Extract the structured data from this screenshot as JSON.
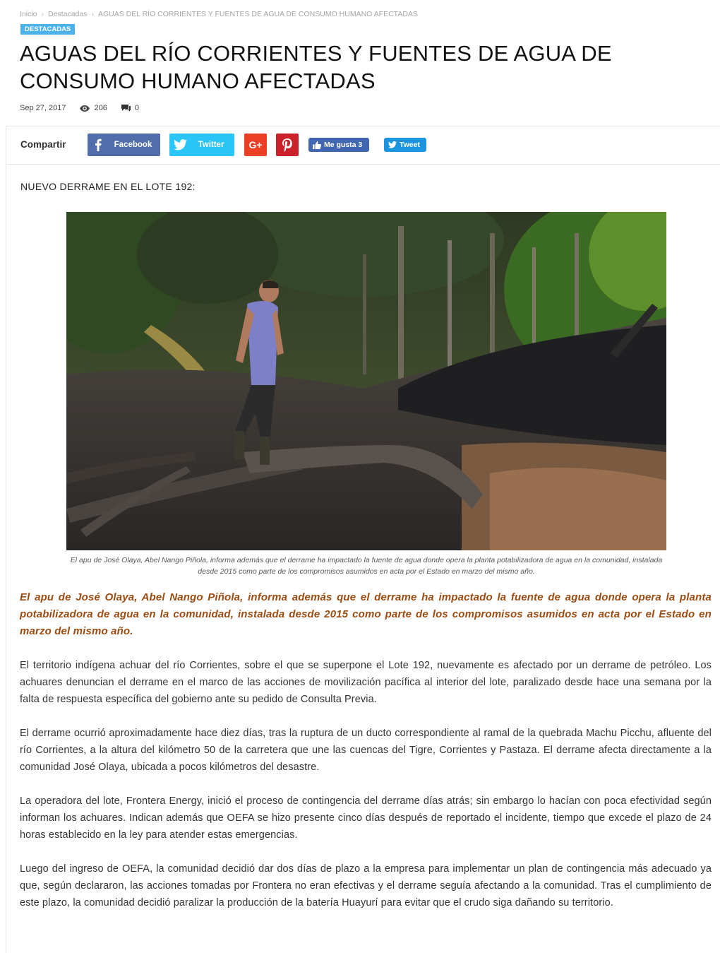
{
  "breadcrumb": {
    "home": "Inicio",
    "category": "Destacadas",
    "current": "AGUAS DEL RÍO CORRIENTES Y FUENTES DE AGUA DE CONSUMO HUMANO AFECTADAS"
  },
  "category_tag": "DESTACADAS",
  "title": "AGUAS DEL RÍO CORRIENTES Y FUENTES DE AGUA DE CONSUMO HUMANO AFECTADAS",
  "meta": {
    "date": "Sep 27, 2017",
    "views": "206",
    "comments": "0"
  },
  "share": {
    "label": "Compartir",
    "facebook": "Facebook",
    "twitter": "Twitter",
    "like": "Me gusta 3",
    "tweet": "Tweet"
  },
  "colors": {
    "accent": "#4db2ec",
    "facebook": "#516eab",
    "twitter": "#29c5f6",
    "googleplus": "#eb4026",
    "pinterest": "#ca212a",
    "lead_text": "#9a4b12"
  },
  "icons": [
    "eye-icon",
    "comment-icon",
    "facebook-icon",
    "twitter-icon",
    "google-plus-icon",
    "pinterest-icon",
    "thumbs-up-icon",
    "twitter-bird-icon"
  ],
  "article": {
    "intro": "NUEVO DERRAME EN EL LOTE 192:",
    "caption": "El apu de José Olaya, Abel Nango Piñola, informa además que el derrame ha impactado la fuente de agua donde opera la planta potabilizadora de agua en la comunidad, instalada desde 2015 como parte de los compromisos asumidos en acta por el Estado en marzo del mismo año.",
    "lead": "El apu de José Olaya, Abel Nango Piñola, informa además que el derrame ha impactado la fuente de agua donde opera la planta potabilizadora de agua en la comunidad, instalada desde 2015 como parte de los compromisos asumidos en acta por el Estado en marzo del mismo año.",
    "paragraphs": [
      "El territorio indígena achuar del río Corrientes, sobre el que se superpone el Lote 192, nuevamente es afectado por un derrame de petróleo. Los achuares denuncian el derrame en el marco de las acciones de movilización pacífica al interior del lote, paralizado desde hace una semana por la falta de respuesta específica del gobierno ante su pedido de Consulta Previa.",
      "El derrame ocurrió aproximadamente hace diez días, tras la ruptura de un ducto correspondiente al ramal de la quebrada Machu Picchu, afluente del río Corrientes, a la altura del kilómetro 50 de la carretera que une las cuencas del Tigre, Corrientes y Pastaza. El derrame afecta directamente a la comunidad José Olaya, ubicada a pocos kilómetros del desastre.",
      "La operadora del lote, Frontera Energy, inició el proceso de contingencia del derrame días atrás; sin embargo lo hacían con poca efectividad según informan los achuares. Indican además que OEFA se hizo presente cinco días después de reportado el incidente, tiempo que excede el plazo de 24 horas establecido en la ley para atender estas emergencias.",
      "Luego del ingreso de OEFA, la comunidad decidió dar dos días de plazo a la empresa para implementar un plan de contingencia más adecuado ya que, según declararon, las acciones tomadas por Frontera no eran efectivas y el derrame seguía afectando a la comunidad. Tras el cumplimiento de este plazo, la comunidad decidió paralizar la producción de la batería Huayurí para evitar que el crudo siga dañando su territorio."
    ]
  }
}
